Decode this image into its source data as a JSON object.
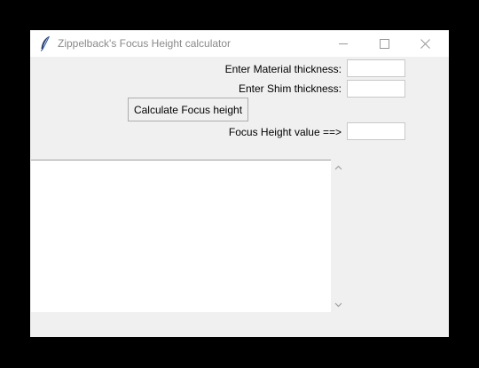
{
  "window": {
    "title": "Zippelback's Focus Height calculator",
    "icon": "feather-icon"
  },
  "form": {
    "material_label": "Enter Material thickness:",
    "material_value": "",
    "shim_label": "Enter Shim thickness:",
    "shim_value": "",
    "calculate_label": "Calculate Focus height",
    "result_label": "Focus Height value ==>",
    "result_value": ""
  },
  "output": {
    "text": ""
  },
  "colors": {
    "window_bg": "#f0f0f0",
    "titlebar_bg": "#ffffff",
    "title_text": "#8a8a8a",
    "icon": "#1e3a78"
  }
}
